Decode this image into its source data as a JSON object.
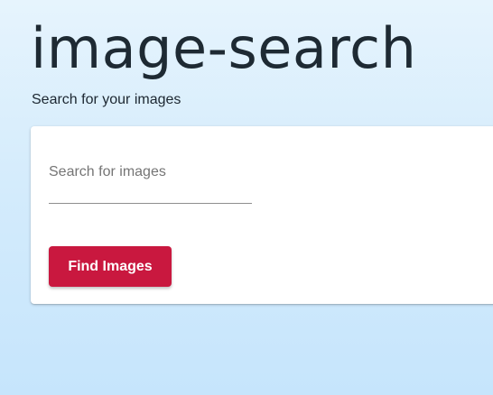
{
  "header": {
    "title": "image-search",
    "subtitle": "Search for your images"
  },
  "search": {
    "placeholder": "Search for images",
    "value": ""
  },
  "actions": {
    "find_label": "Find Images"
  },
  "colors": {
    "primary_button": "#c9183f",
    "title_text": "#1e2a33",
    "background_top": "#e6f4fd",
    "background_bottom": "#c6e5fc"
  }
}
